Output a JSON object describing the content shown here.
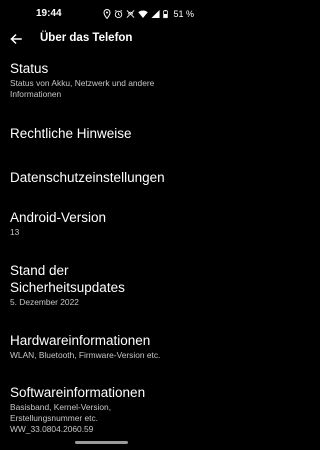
{
  "status_bar": {
    "time": "19:44",
    "battery": "51 %",
    "icons": [
      "location-icon",
      "alarm-icon",
      "do-not-disturb-icon",
      "wifi-icon",
      "signal-icon",
      "battery-icon"
    ]
  },
  "app_bar": {
    "title": "Über das Telefon",
    "back_icon": "arrow-back-icon"
  },
  "items": [
    {
      "title": "Status",
      "subtitle": "Status von Akku, Netzwerk und andere Informationen"
    },
    {
      "title": "Rechtliche Hinweise",
      "subtitle": ""
    },
    {
      "title": "Datenschutzeinstellungen",
      "subtitle": ""
    },
    {
      "title": "Android-Version",
      "subtitle": "13"
    },
    {
      "title": "Stand der Sicherheitsupdates",
      "subtitle": "5. Dezember 2022"
    },
    {
      "title": "Hardwareinformationen",
      "subtitle": "WLAN, Bluetooth, Firmware-Version etc."
    },
    {
      "title": "Softwareinformationen",
      "subtitle": "Basisband, Kernel-Version, Erstellungsnummer etc. WW_33.0804.2060.59"
    }
  ],
  "colors": {
    "background": "#000000",
    "text_primary": "#ffffff",
    "text_secondary": "#c7c7c7"
  }
}
